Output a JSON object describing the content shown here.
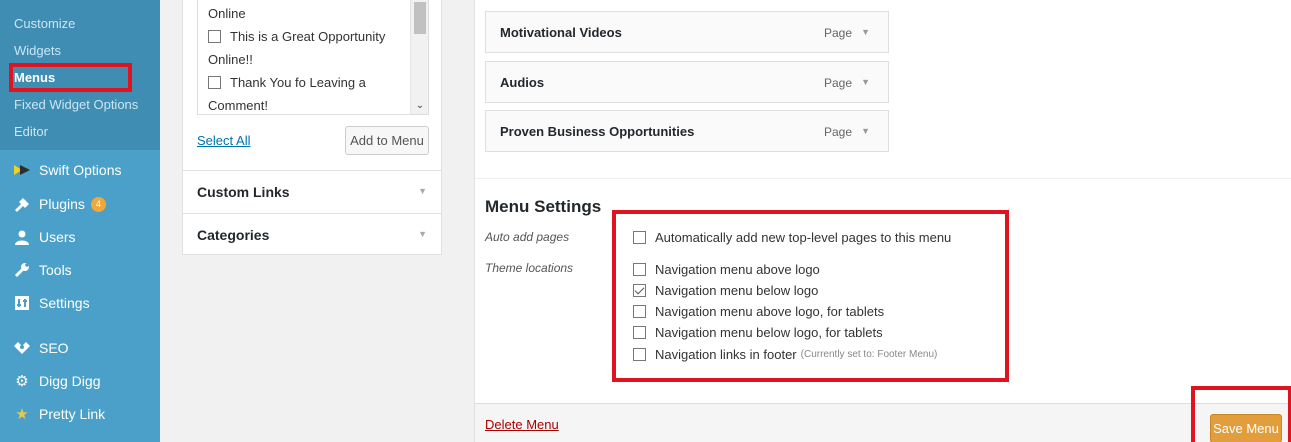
{
  "sidebar": {
    "submenu": [
      "Customize",
      "Widgets",
      "Menus",
      "Fixed Widget Options",
      "Editor"
    ],
    "items": [
      {
        "label": "Swift Options",
        "icon": "swift-icon"
      },
      {
        "label": "Plugins",
        "icon": "plugin-icon",
        "badge": "4"
      },
      {
        "label": "Users",
        "icon": "users-icon"
      },
      {
        "label": "Tools",
        "icon": "wrench-icon"
      },
      {
        "label": "Settings",
        "icon": "settings-icon"
      },
      {
        "label": "SEO",
        "icon": "seo-icon"
      },
      {
        "label": "Digg Digg",
        "icon": "gear-icon"
      },
      {
        "label": "Pretty Link",
        "icon": "star-icon"
      }
    ]
  },
  "pages_box": {
    "lines": [
      "Online",
      "This is a Great Opportunity",
      "Online!!",
      "Thank You fo Leaving a",
      "Comment!"
    ],
    "select_all": "Select All",
    "add_to_menu": "Add to Menu"
  },
  "accordion": [
    "Custom Links",
    "Categories"
  ],
  "menu_items": [
    {
      "title": "Motivational Videos",
      "type": "Page"
    },
    {
      "title": "Audios",
      "type": "Page"
    },
    {
      "title": "Proven Business Opportunities",
      "type": "Page"
    }
  ],
  "menu_settings": {
    "title": "Menu Settings",
    "auto_add_label": "Auto add pages",
    "auto_add_option": "Automatically add new top-level pages to this menu",
    "theme_locations_label": "Theme locations",
    "locations": [
      {
        "label": "Navigation menu above logo",
        "checked": false
      },
      {
        "label": "Navigation menu below logo",
        "checked": true
      },
      {
        "label": "Navigation menu above logo, for tablets",
        "checked": false
      },
      {
        "label": "Navigation menu below logo, for tablets",
        "checked": false
      },
      {
        "label": "Navigation links in footer",
        "checked": false,
        "note": "(Currently set to: Footer Menu)"
      }
    ]
  },
  "footer": {
    "delete_menu": "Delete Menu",
    "save_menu": "Save Menu"
  },
  "colors": {
    "sidebar": "#4aa0c9",
    "submenu": "#3f8db3",
    "highlight": "#e0141e",
    "save_button": "#e29e3d",
    "link": "#0073aa",
    "delete": "#aa0000"
  }
}
